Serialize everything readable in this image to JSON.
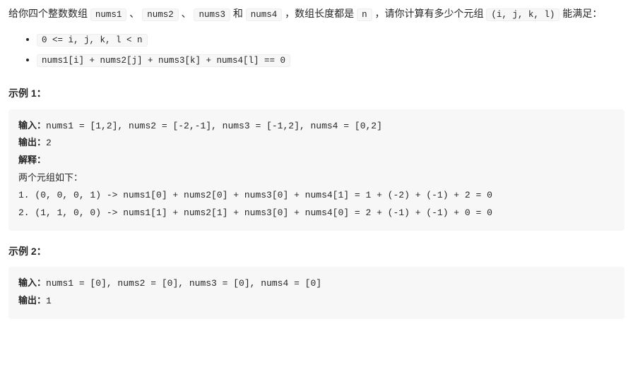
{
  "problem": {
    "intro_part1": "给你四个整数数组 ",
    "arr1": "nums1",
    "sep1": " 、 ",
    "arr2": "nums2",
    "sep2": " 、 ",
    "arr3": "nums3",
    "sep3": " 和 ",
    "arr4": "nums4",
    "intro_part2": " ，数组长度都是 ",
    "n_var": "n",
    "intro_part3": " ，请你计算有多少个元组 ",
    "tuple": "(i, j, k, l)",
    "intro_part4": " 能满足：",
    "conditions": [
      "0 <= i, j, k, l < n",
      "nums1[i] + nums2[j] + nums3[k] + nums4[l] == 0"
    ]
  },
  "example1": {
    "heading": "示例 1：",
    "input_label": "输入：",
    "input_value": "nums1 = [1,2], nums2 = [-2,-1], nums3 = [-1,2], nums4 = [0,2]",
    "output_label": "输出：",
    "output_value": "2",
    "explain_label": "解释：",
    "explain_line1": "两个元组如下：",
    "explain_line2": "1. (0, 0, 0, 1) -> nums1[0] + nums2[0] + nums3[0] + nums4[1] = 1 + (-2) + (-1) + 2 = 0",
    "explain_line3": "2. (1, 1, 0, 0) -> nums1[1] + nums2[1] + nums3[0] + nums4[0] = 2 + (-1) + (-1) + 0 = 0"
  },
  "example2": {
    "heading": "示例 2：",
    "input_label": "输入：",
    "input_value": "nums1 = [0], nums2 = [0], nums3 = [0], nums4 = [0]",
    "output_label": "输出：",
    "output_value": "1"
  }
}
